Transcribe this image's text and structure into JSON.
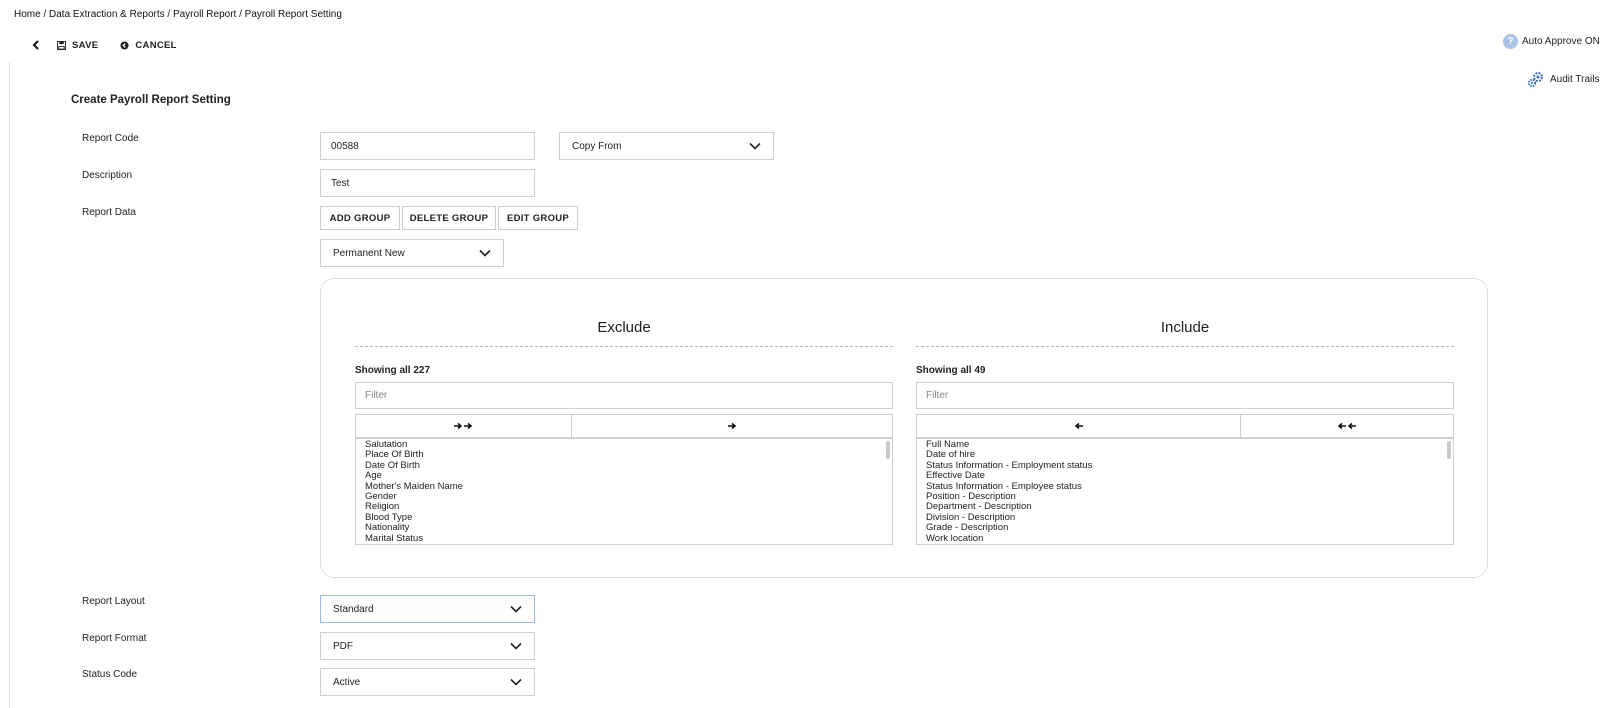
{
  "breadcrumb": "Home / Data Extraction & Reports / Payroll Report / Payroll Report Setting",
  "toolbar": {
    "save_label": "SAVE",
    "cancel_label": "CANCEL"
  },
  "auto_approve": {
    "icon": "?",
    "label": "Auto Approve ON"
  },
  "audit_trails": {
    "label": "Audit Trails"
  },
  "form": {
    "title": "Create Payroll Report Setting",
    "report_code_label": "Report Code",
    "report_code_value": "00588",
    "copy_from": "Copy From",
    "description_label": "Description",
    "description_value": "Test",
    "report_data_label": "Report Data",
    "add_group": "ADD GROUP",
    "delete_group": "DELETE GROUP",
    "edit_group": "EDIT GROUP",
    "group_select": "Permanent New",
    "report_layout_label": "Report Layout",
    "report_layout_value": "Standard",
    "report_format_label": "Report Format",
    "report_format_value": "PDF",
    "status_code_label": "Status Code",
    "status_code_value": "Active"
  },
  "dual_list": {
    "exclude": {
      "title": "Exclude",
      "showing": "Showing all 227",
      "filter_placeholder": "Filter",
      "items": [
        "Salutation",
        "Place Of Birth",
        "Date Of Birth",
        "Age",
        "Mother's Maiden Name",
        "Gender",
        "Religion",
        "Blood Type",
        "Nationality",
        "Marital Status"
      ]
    },
    "include": {
      "title": "Include",
      "showing": "Showing all 49",
      "filter_placeholder": "Filter",
      "items": [
        "Full Name",
        "Date of hire",
        "Status Information - Employment status",
        "Effective Date",
        "Status Information - Employee status",
        "Position - Description",
        "Department - Description",
        "Division - Description",
        "Grade - Description",
        "Work location"
      ]
    }
  },
  "colors": {
    "accent_help": "#a9c3e4",
    "audit_icon": "#3d6fb6",
    "border": "#cfcfcf",
    "focus_border": "#9bb9e6"
  }
}
